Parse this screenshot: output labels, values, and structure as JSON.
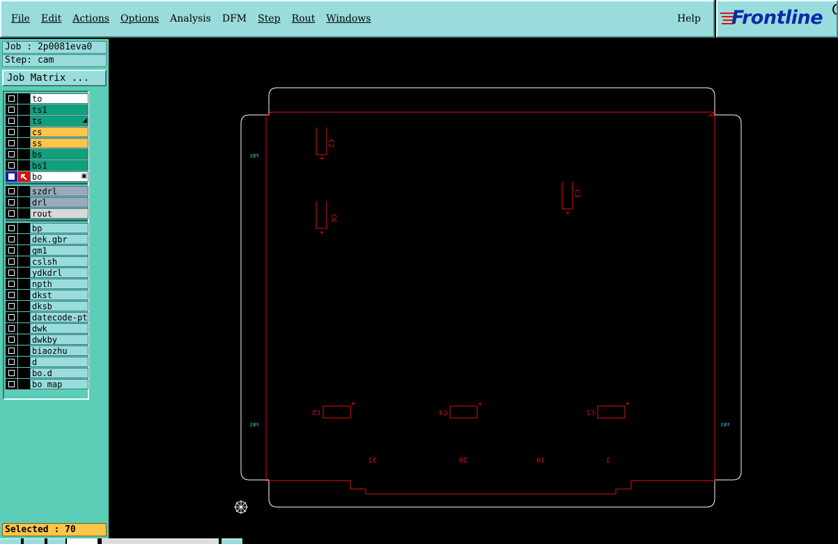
{
  "menu": {
    "items": [
      {
        "label": "File",
        "ul": true
      },
      {
        "label": "Edit",
        "ul": true
      },
      {
        "label": "Actions",
        "ul": true
      },
      {
        "label": "Options",
        "ul": true
      },
      {
        "label": "Analysis",
        "ul": false
      },
      {
        "label": "DFM",
        "ul": false
      },
      {
        "label": "Step",
        "ul": true
      },
      {
        "label": "Rout",
        "ul": true
      },
      {
        "label": "Windows",
        "ul": true
      }
    ],
    "help": "Help"
  },
  "logo": {
    "text": "Frontline",
    "corner": "C"
  },
  "job": {
    "line": "Job : 2p0081eva0",
    "step": "Step: cam"
  },
  "job_matrix_label": "Job Matrix ...",
  "layers": [
    {
      "name": "to",
      "color": "#ffffff"
    },
    {
      "name": "ts1",
      "color": "#10a07c"
    },
    {
      "name": "ts",
      "color": "#10a07c",
      "mark": "tool"
    },
    {
      "name": "cs",
      "color": "#ffc44a"
    },
    {
      "name": "ss",
      "color": "#ffc44a"
    },
    {
      "name": "bs",
      "color": "#10a07c"
    },
    {
      "name": "bs1",
      "color": "#10a07c"
    },
    {
      "name": "bo",
      "color": "#ffffff",
      "active": true,
      "mark": "grid"
    },
    {
      "name": "szdrl",
      "color": "#9aaabb",
      "sep_before": true
    },
    {
      "name": "drl",
      "color": "#9aaabb"
    },
    {
      "name": "rout",
      "color": "#d8d8d8"
    },
    {
      "name": "bp",
      "color": "#9adcdc",
      "sep_before": true
    },
    {
      "name": "dek.gbr",
      "color": "#9adcdc"
    },
    {
      "name": "gm1",
      "color": "#9adcdc"
    },
    {
      "name": "cslsh",
      "color": "#9adcdc"
    },
    {
      "name": "ydkdrl",
      "color": "#9adcdc"
    },
    {
      "name": "npth",
      "color": "#9adcdc"
    },
    {
      "name": "dkst",
      "color": "#9adcdc"
    },
    {
      "name": "dksb",
      "color": "#9adcdc"
    },
    {
      "name": "datecode-pto",
      "color": "#9adcdc"
    },
    {
      "name": "dwk",
      "color": "#9adcdc"
    },
    {
      "name": "dwkby",
      "color": "#9adcdc"
    },
    {
      "name": "biaozhu",
      "color": "#9adcdc"
    },
    {
      "name": "d",
      "color": "#9adcdc"
    },
    {
      "name": "bo.d",
      "color": "#9adcdc"
    },
    {
      "name": "bo_map",
      "color": "#9adcdc"
    }
  ],
  "selected": "Selected : 70",
  "board": {
    "outline_color": "#ffffff",
    "layer_color": "#e01010",
    "fiducial_color": "#40c8e0",
    "components": [
      {
        "label": "C2",
        "kind": "v"
      },
      {
        "label": "C6",
        "kind": "v"
      },
      {
        "label": "C3",
        "kind": "v"
      },
      {
        "label": "C5",
        "kind": "h"
      },
      {
        "label": "C4",
        "kind": "h"
      },
      {
        "label": "C2",
        "kind": "h"
      }
    ],
    "bottom_texts": [
      "32",
      "20",
      "10",
      "1"
    ],
    "fiducials": [
      "FB2",
      "FB1",
      "FB3"
    ]
  }
}
